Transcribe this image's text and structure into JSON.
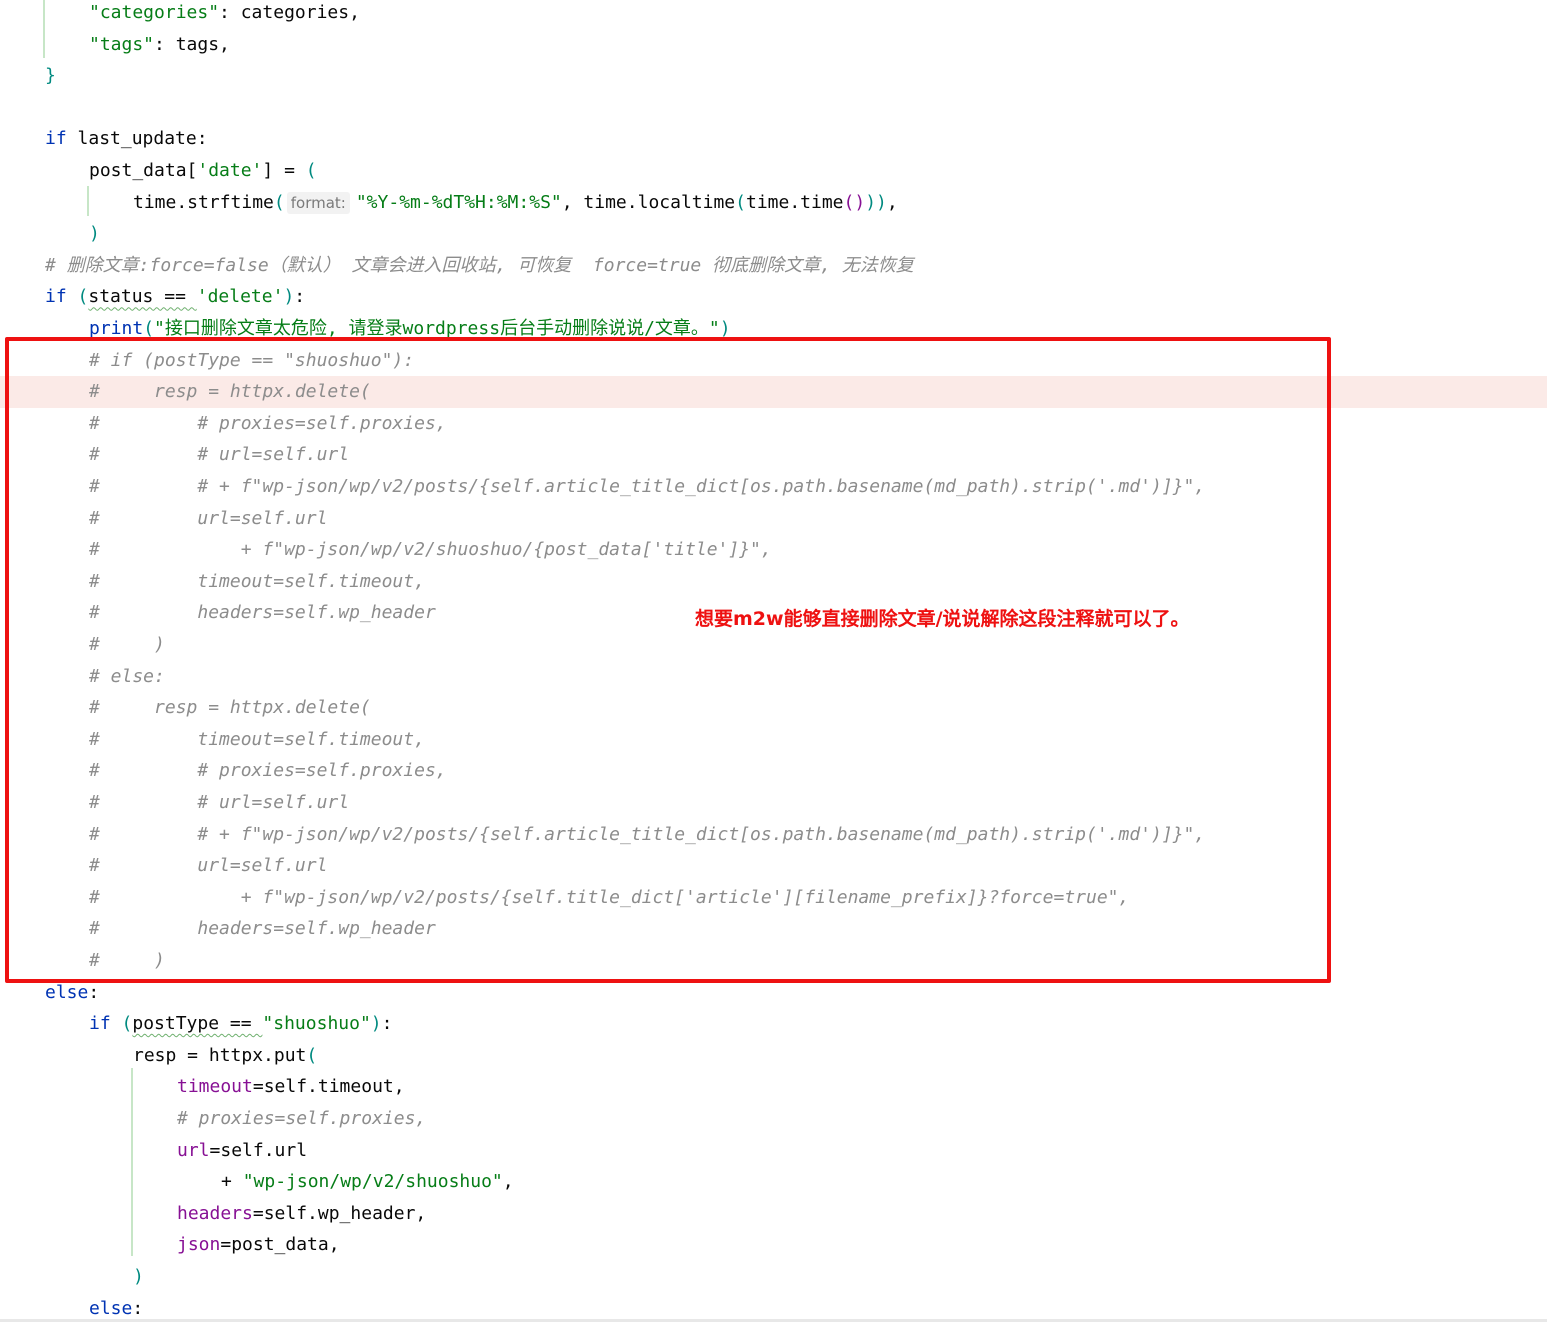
{
  "lines": [
    [
      [
        "st",
        "\"categories\""
      ],
      [
        "pl",
        ": categories,"
      ]
    ],
    [
      [
        "st",
        "\"tags\""
      ],
      [
        "pl",
        ": tags,"
      ]
    ],
    [
      [
        "bk",
        "}"
      ]
    ],
    [],
    [
      [
        "kw",
        "if"
      ],
      [
        "pl",
        " last_update:"
      ]
    ],
    [
      [
        "pl",
        "post_data["
      ],
      [
        "st",
        "'date'"
      ],
      [
        "pl",
        "] = "
      ],
      [
        "bk",
        "("
      ]
    ],
    [
      [
        "pl",
        "time.strftime"
      ],
      [
        "bk",
        "("
      ],
      [
        "hint",
        "format:"
      ],
      [
        "st",
        "\"%Y-%m-%dT%H:%M:%S\""
      ],
      [
        "pl",
        ", time.localtime"
      ],
      [
        "bk",
        "("
      ],
      [
        "pl",
        "time.time"
      ],
      [
        "pm",
        "()"
      ],
      [
        "bk",
        "))"
      ],
      [
        "pl",
        ","
      ]
    ],
    [
      [
        "bk",
        ")"
      ]
    ],
    [
      [
        "cm",
        "# 删除文章:force=false（默认） 文章会进入回收站, 可恢复  force=true 彻底删除文章, 无法恢复"
      ]
    ],
    [
      [
        "kw",
        "if"
      ],
      [
        "pl",
        " "
      ],
      [
        "bk",
        "("
      ],
      [
        "sq",
        "status == "
      ],
      [
        "st",
        "'delete'"
      ],
      [
        "bk",
        ")"
      ],
      [
        "pl",
        ":"
      ]
    ],
    [
      [
        "kw",
        "print"
      ],
      [
        "bk",
        "("
      ],
      [
        "st",
        "\"接口删除文章太危险, 请登录wordpress后台手动删除说说/文章。\""
      ],
      [
        "bk",
        ")"
      ]
    ],
    [
      [
        "cm",
        "# if (postType == \"shuoshuo\"):"
      ]
    ],
    [
      [
        "cm",
        "#     resp = httpx.delete("
      ]
    ],
    [
      [
        "cm",
        "#         # proxies=self.proxies,"
      ]
    ],
    [
      [
        "cm",
        "#         # url=self.url"
      ]
    ],
    [
      [
        "cm",
        "#         # + f\"wp-json/wp/v2/posts/{self.article_title_dict[os.path.basename(md_path).strip('.md')]}\","
      ]
    ],
    [
      [
        "cm",
        "#         url=self.url"
      ]
    ],
    [
      [
        "cm",
        "#             + f\"wp-json/wp/v2/shuoshuo/{post_data['title']}\","
      ]
    ],
    [
      [
        "cm",
        "#         timeout=self.timeout,"
      ]
    ],
    [
      [
        "cm",
        "#         headers=self.wp_header"
      ]
    ],
    [
      [
        "cm",
        "#     )"
      ]
    ],
    [
      [
        "cm",
        "# else:"
      ]
    ],
    [
      [
        "cm",
        "#     resp = httpx.delete("
      ]
    ],
    [
      [
        "cm",
        "#         timeout=self.timeout,"
      ]
    ],
    [
      [
        "cm",
        "#         # proxies=self.proxies,"
      ]
    ],
    [
      [
        "cm",
        "#         # url=self.url"
      ]
    ],
    [
      [
        "cm",
        "#         # + f\"wp-json/wp/v2/posts/{self.article_title_dict[os.path.basename(md_path).strip('.md')]}\","
      ]
    ],
    [
      [
        "cm",
        "#         url=self.url"
      ]
    ],
    [
      [
        "cm",
        "#             + f\"wp-json/wp/v2/posts/{self.title_dict['article'][filename_prefix]}?force=true\","
      ]
    ],
    [
      [
        "cm",
        "#         headers=self.wp_header"
      ]
    ],
    [
      [
        "cm",
        "#     )"
      ]
    ],
    [
      [
        "kw",
        "else"
      ],
      [
        "pl",
        ":"
      ]
    ],
    [
      [
        "kw",
        "if"
      ],
      [
        "pl",
        " "
      ],
      [
        "bk",
        "("
      ],
      [
        "sq",
        "postType == "
      ],
      [
        "st",
        "\"shuoshuo\""
      ],
      [
        "bk",
        ")"
      ],
      [
        "pl",
        ":"
      ]
    ],
    [
      [
        "pl",
        "resp = httpx.put"
      ],
      [
        "bk",
        "("
      ]
    ],
    [
      [
        "pm",
        "timeout"
      ],
      [
        "pl",
        "=self.timeout,"
      ]
    ],
    [
      [
        "cm",
        "# proxies=self.proxies,"
      ]
    ],
    [
      [
        "pm",
        "url"
      ],
      [
        "pl",
        "=self.url"
      ]
    ],
    [
      [
        "pl",
        "+ "
      ],
      [
        "st",
        "\"wp-json/wp/v2/shuoshuo\""
      ],
      [
        "pl",
        ","
      ]
    ],
    [
      [
        "pm",
        "headers"
      ],
      [
        "pl",
        "=self.wp_header,"
      ]
    ],
    [
      [
        "pm",
        "json"
      ],
      [
        "pl",
        "=post_data,"
      ]
    ],
    [
      [
        "bk",
        ")"
      ]
    ],
    [
      [
        "kw",
        "else"
      ],
      [
        "pl",
        ":"
      ]
    ]
  ],
  "annotation": "想要m2w能够直接删除文章/说说解除这段注释就可以了。",
  "colors": {
    "keyword": "#0033b3",
    "string": "#067d17",
    "comment": "#8c8c8c",
    "param": "#871094",
    "highlight_line": "#fbeae7",
    "annotation_red": "#ee1111"
  }
}
